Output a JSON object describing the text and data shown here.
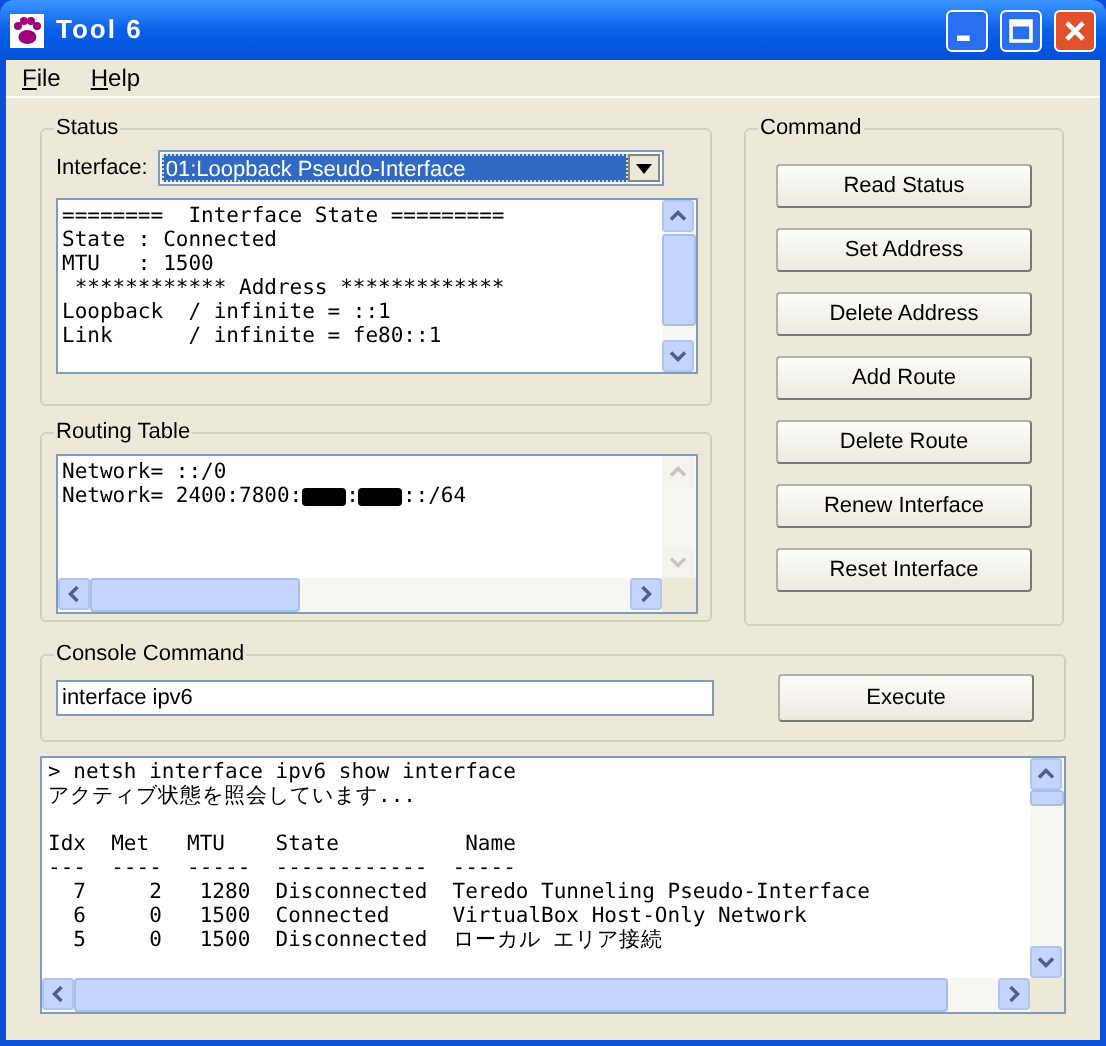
{
  "window": {
    "title": "Tool 6"
  },
  "menu": [
    "File",
    "Help"
  ],
  "status": {
    "title": "Status",
    "interface_label": "Interface:",
    "interface_value": "01:Loopback Pseudo-Interface",
    "lines": [
      "========  Interface State =========",
      "State : Connected",
      "MTU   : 1500",
      " ************ Address *************",
      "Loopback  / infinite = ::1",
      "Link      / infinite = fe80::1"
    ]
  },
  "routing_table": {
    "title": "Routing Table",
    "lines": [
      [
        {
          "kind": "text",
          "text": "Network= ::/0"
        }
      ],
      [
        {
          "kind": "text",
          "text": "Network= 2400:7800:"
        },
        {
          "kind": "redacted"
        },
        {
          "kind": "text",
          "text": ":"
        },
        {
          "kind": "redacted"
        },
        {
          "kind": "text",
          "text": "::/64"
        }
      ]
    ]
  },
  "command": {
    "title": "Command",
    "buttons": [
      "Read Status",
      "Set Address",
      "Delete Address",
      "Add Route",
      "Delete Route",
      "Renew Interface",
      "Reset Interface"
    ]
  },
  "console_command": {
    "title": "Console Command",
    "value": "interface ipv6",
    "button": "Execute"
  },
  "output": {
    "lines": [
      "> netsh interface ipv6 show interface",
      "アクティブ状態を照会しています..."
    ],
    "table": [
      "Idx  Met   MTU    State          Name",
      "---  ----  -----  ------------  -----",
      "  7     2   1280  Disconnected  Teredo Tunneling Pseudo-Interface",
      "  6     0   1500  Connected     VirtualBox Host-Only Network",
      "  5     0   1500  Disconnected  ローカル エリア接続"
    ]
  }
}
